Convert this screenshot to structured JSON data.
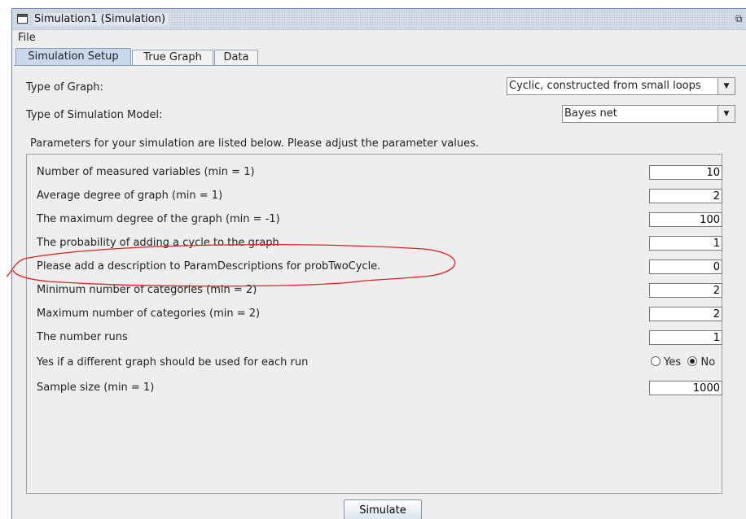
{
  "window": {
    "title": "Simulation1 (Simulation)"
  },
  "menu": {
    "file": "File"
  },
  "tabs": [
    {
      "label": "Simulation Setup",
      "active": true
    },
    {
      "label": "True Graph",
      "active": false
    },
    {
      "label": "Data",
      "active": false
    }
  ],
  "setup": {
    "graph_type_label": "Type of Graph:",
    "graph_type_value": "Cyclic, constructed from small loops",
    "model_type_label": "Type of Simulation Model:",
    "model_type_value": "Bayes net",
    "params_intro": "Parameters for your simulation are listed below. Please adjust the parameter values."
  },
  "params": [
    {
      "label": "Number of measured variables (min = 1)",
      "value": "10"
    },
    {
      "label": "Average degree of graph (min = 1)",
      "value": "2"
    },
    {
      "label": "The maximum degree of the graph (min = -1)",
      "value": "100"
    },
    {
      "label": "The probability of adding a cycle to the graph",
      "value": "1"
    },
    {
      "label": "Please add a description to ParamDescriptions for probTwoCycle.",
      "value": "0"
    },
    {
      "label": "Minimum number of categories (min = 2)",
      "value": "2"
    },
    {
      "label": "Maximum number of categories (min = 2)",
      "value": "2"
    },
    {
      "label": "The number runs",
      "value": "1"
    }
  ],
  "different_graph": {
    "label": "Yes if a different graph should be used for each run",
    "yes": "Yes",
    "no": "No",
    "selected": "No"
  },
  "sample_size": {
    "label": "Sample size (min = 1)",
    "value": "1000"
  },
  "buttons": {
    "simulate": "Simulate"
  },
  "annotation": {
    "color": "#e02020"
  }
}
